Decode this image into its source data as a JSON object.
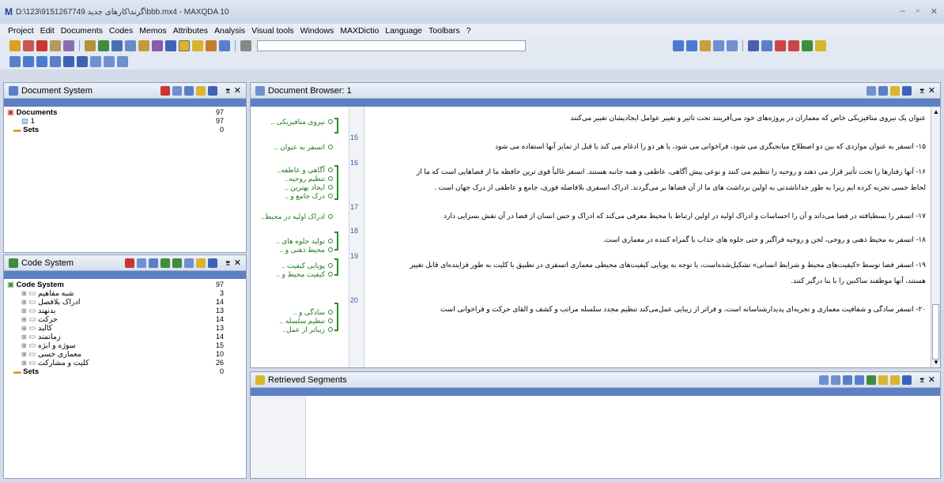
{
  "window": {
    "logo": "M",
    "title": "D:\\123\\9151267749 گرند\\کارهای جدید\\bbb.mx4 - MAXQDA 10"
  },
  "menu": [
    "Project",
    "Edit",
    "Documents",
    "Codes",
    "Memos",
    "Attributes",
    "Analysis",
    "Visual tools",
    "Windows",
    "MAXDictio",
    "Language",
    "Toolbars",
    "?"
  ],
  "document_system": {
    "title": "Document System",
    "rows": [
      {
        "label": "Documents",
        "count": "97"
      },
      {
        "label": "1",
        "count": "97"
      },
      {
        "label": "Sets",
        "count": "0"
      }
    ]
  },
  "code_system": {
    "title": "Code System",
    "root": {
      "label": "Code System",
      "count": "97"
    },
    "codes": [
      {
        "label": "شبه مفاهیم",
        "count": "3"
      },
      {
        "label": "ادراک بلافصل",
        "count": "14"
      },
      {
        "label": "بدنهند",
        "count": "13"
      },
      {
        "label": "حرکت",
        "count": "14"
      },
      {
        "label": "کالبد",
        "count": "13"
      },
      {
        "label": "زمانمند",
        "count": "14"
      },
      {
        "label": "سوژه و ابژه",
        "count": "15"
      },
      {
        "label": "معماری حسی",
        "count": "10"
      },
      {
        "label": "کلیت و مشارکت",
        "count": "26"
      }
    ],
    "sets": {
      "label": "Sets",
      "count": "0"
    }
  },
  "document_browser": {
    "title": "Document Browser: 1",
    "codes": [
      "نیروی متافیزیکی ..",
      "اتسفر به عنوان ..",
      "آگاهی و عاطفه..",
      "تنظیم روحیه..",
      "ایجاد بهترین ..",
      "درک جامع و ..",
      "ادراک اولیه در محیط..",
      "تولید جلوه های ..",
      "محیط ذهنی و ..",
      "پویایی کیفیت ..",
      "کیفیت محیط و ..",
      "سادگی و ..",
      "تنظیم سلسله ..",
      "زیباتر از عمل.."
    ],
    "paragraphs": [
      {
        "num": "",
        "text": "عنوان یک نیروی متافیزیکی خاص که معماران در پروژه‌های خود می‌آفرینند تحت تاثیر و تغییر عوامل ایجادیشان تغییر می‌کنند"
      },
      {
        "num": "15",
        "text": "۱۵- اتسفر به عنوان مواردی که بین دو اصطلاح میانجیگری می شود، فراخوانی می شود، یا هر دو را ادغام می کند یا قبل از تمایز آنها استفاده می شود"
      },
      {
        "num": "16",
        "text": "۱۶- آنها رفتارها را تحت تأثیر قرار می دهند و روحیه را تنظیم می کنند و نوعی پیش آگاهی، عاطفی و همه جانبه هستند. اتسفر غالباً قوی ترین حافظه ما از فضاهایی است که ما از"
      },
      {
        "num": "",
        "text": "لحاظ حسی تجربه کرده ایم زیرا به طور جداناشدنی به اولین برداشت های ما از آن فضاها بر می‌گردند. ادراک اتسفری بلافاصله فوری، جامع و عاطفی از درک جهان است ."
      },
      {
        "num": "17",
        "text": "۱۷- اتسفر را بسطیافته در فضا می‌داند و آن را احساسات و ادراک اولیه در اولین ارتباط با محیط معرفی می‌کند که ادراک و حس انسان از فضا در آن نقش بسزایی دارد"
      },
      {
        "num": "18",
        "text": "۱۸- اتسفر به محیط ذهنی و روحی، لحن و روحیه فراگیر و حتی جلوه های جذاب یا گمراه کننده در معماری است."
      },
      {
        "num": "19",
        "text": "۱۹- اتسفر فضا توسط «کیفیت‌های محیط و شرایط انسانی» تشکیل‌شده‌است، با توجه به پویایی کیفیت‌های محیطی معماری اتسفری در تطبیق با کلیت به طور فزاینده‌ای قابل تغییر"
      },
      {
        "num": "",
        "text": "هستند، آنها موظفند ساکنین را با بنا درگیر کنند."
      },
      {
        "num": "20",
        "text": "۲۰- اتسفر سادگی و شفافیت معماری و تجربه‌ای پدیدارشناسانه است، و فراتر از زیبایی عمل‌می‌کند تنظیم مجدد سلسله مراتب و کشف و القای حرکت و فراخوانی است"
      }
    ]
  },
  "retrieved_segments": {
    "title": "Retrieved Segments"
  }
}
